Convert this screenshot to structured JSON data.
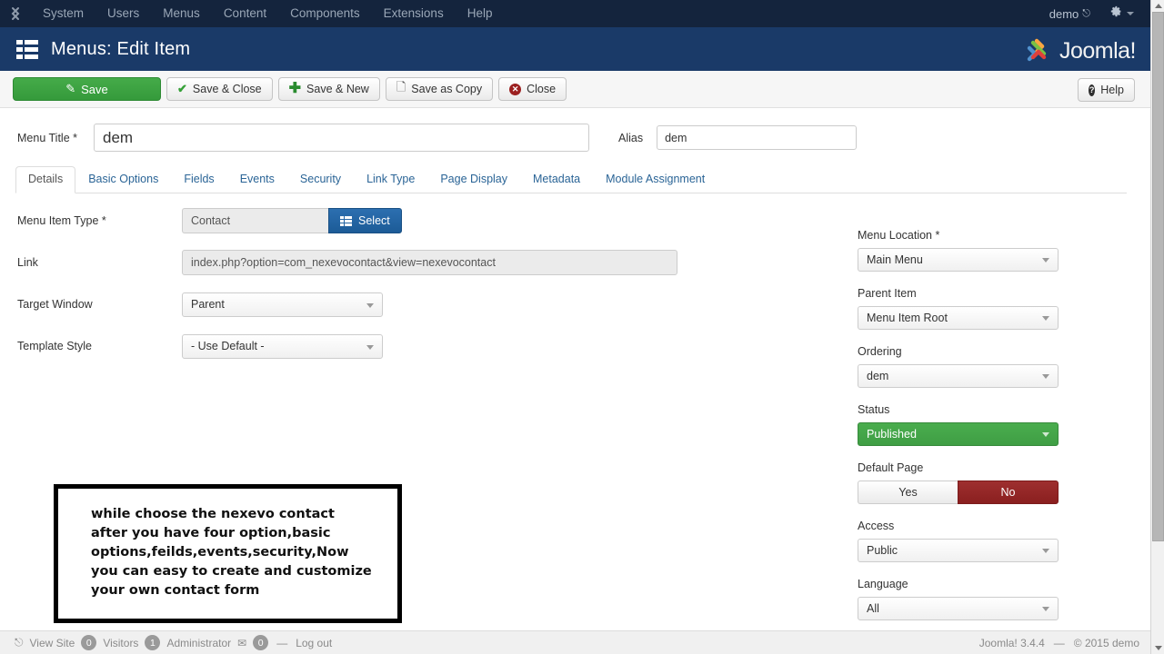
{
  "topbar": {
    "brand_icon": "joomla-logo-icon",
    "nav": [
      {
        "label": "System"
      },
      {
        "label": "Users"
      },
      {
        "label": "Menus"
      },
      {
        "label": "Content"
      },
      {
        "label": "Components"
      },
      {
        "label": "Extensions"
      },
      {
        "label": "Help"
      }
    ],
    "user": "demo",
    "user_icon": "external-link-icon",
    "gear_icon": "gear-icon",
    "caret_icon": "chevron-down-icon"
  },
  "subhead": {
    "icon": "menu-list-icon",
    "title": "Menus: Edit Item",
    "logo_text": "Joomla!"
  },
  "toolbar": {
    "save_label": "Save",
    "save_icon": "pencil-square-icon",
    "save_close_label": "Save & Close",
    "save_close_icon": "check-icon",
    "save_new_label": "Save & New",
    "save_new_icon": "plus-icon",
    "save_copy_label": "Save as Copy",
    "save_copy_icon": "copy-icon",
    "close_label": "Close",
    "close_icon": "close-circle-icon",
    "help_label": "Help",
    "help_icon": "question-circle-icon"
  },
  "form": {
    "menu_title_label": "Menu Title *",
    "menu_title_value": "dem",
    "alias_label": "Alias",
    "alias_value": "dem"
  },
  "tabs": [
    {
      "label": "Details",
      "active": true
    },
    {
      "label": "Basic Options",
      "active": false
    },
    {
      "label": "Fields",
      "active": false
    },
    {
      "label": "Events",
      "active": false
    },
    {
      "label": "Security",
      "active": false
    },
    {
      "label": "Link Type",
      "active": false
    },
    {
      "label": "Page Display",
      "active": false
    },
    {
      "label": "Metadata",
      "active": false
    },
    {
      "label": "Module Assignment",
      "active": false
    }
  ],
  "details": {
    "menu_item_type_label": "Menu Item Type *",
    "menu_item_type_value": "Contact",
    "select_button_label": "Select",
    "select_button_icon": "grid-list-icon",
    "link_label": "Link",
    "link_value": "index.php?option=com_nexevocontact&view=nexevocontact",
    "target_window_label": "Target Window",
    "target_window_value": "Parent",
    "template_style_label": "Template Style",
    "template_style_value": "- Use Default -"
  },
  "annotation": {
    "text": "while choose the nexevo contact after you have four option,basic options,feilds,events,security,Now you can easy to create and customize your own contact form"
  },
  "sidebar": {
    "menu_location_label": "Menu Location *",
    "menu_location_value": "Main Menu",
    "parent_item_label": "Parent Item",
    "parent_item_value": "Menu Item Root",
    "ordering_label": "Ordering",
    "ordering_value": "dem",
    "status_label": "Status",
    "status_value": "Published",
    "default_page_label": "Default Page",
    "default_page_yes": "Yes",
    "default_page_no": "No",
    "default_page_selected": "No",
    "access_label": "Access",
    "access_value": "Public",
    "language_label": "Language",
    "language_value": "All"
  },
  "footer": {
    "view_site": "View Site",
    "view_site_icon": "external-link-icon",
    "visitors_count": "0",
    "visitors_label": "Visitors",
    "admin_count": "1",
    "admin_label": "Administrator",
    "mail_icon": "envelope-icon",
    "mail_count": "0",
    "separator": "—",
    "log_out": "Log out",
    "version": "Joomla! 3.4.4",
    "version_sep": "—",
    "copyright": "© 2015 demo",
    "caret_icon": "chevron-down-icon"
  },
  "colors": {
    "topbar": "#14243d",
    "subhead": "#1a3a68",
    "save_green": "#3b9e40",
    "select_blue": "#1c5b97",
    "published_green": "#44a649",
    "no_red": "#8f2424",
    "link_blue": "#2a6496"
  }
}
